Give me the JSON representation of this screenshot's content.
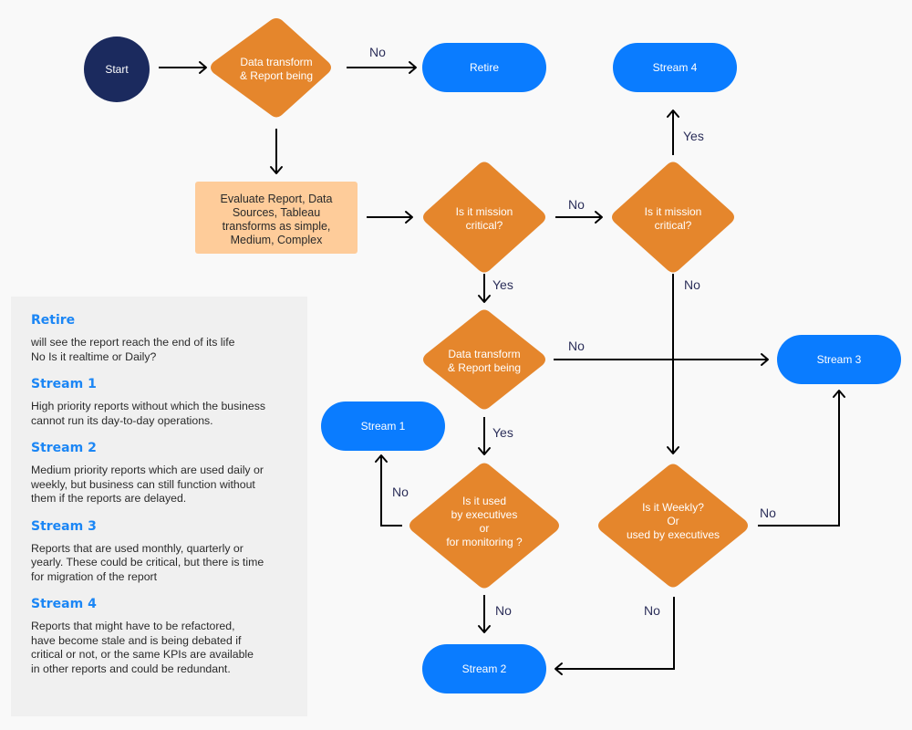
{
  "colors": {
    "start": "#1b2a5e",
    "decision": "#e5862c",
    "process": "#fecc9a",
    "terminal": "#0a7cff",
    "legend_title": "#1b86f5",
    "legend_bg": "#f0f0f0",
    "edge_label": "#2c2f5a"
  },
  "nodes": {
    "start": {
      "label": "Start"
    },
    "decision_transform_1": {
      "lines": [
        "Data transform",
        "& Report being"
      ]
    },
    "retire": {
      "label": "Retire"
    },
    "evaluate": {
      "lines": [
        "Evaluate Report, Data",
        "Sources, Tableau",
        "transforms as simple,",
        "Medium, Complex"
      ]
    },
    "decision_mission_1": {
      "lines": [
        "Is it mission",
        "critical?"
      ]
    },
    "decision_mission_2": {
      "lines": [
        "Is it mission",
        "critical?"
      ]
    },
    "stream4": {
      "label": "Stream 4"
    },
    "decision_transform_2": {
      "lines": [
        "Data transform",
        "& Report being"
      ]
    },
    "stream3": {
      "label": "Stream 3"
    },
    "stream1": {
      "label": "Stream 1"
    },
    "decision_executives": {
      "lines": [
        "Is it used",
        "by executives",
        "or",
        "for monitoring ?"
      ]
    },
    "decision_weekly": {
      "lines": [
        "Is it Weekly?",
        "Or",
        "used by executives"
      ]
    },
    "stream2": {
      "label": "Stream 2"
    }
  },
  "edges": [
    {
      "from": "start",
      "to": "decision_transform_1",
      "label": ""
    },
    {
      "from": "decision_transform_1",
      "to": "retire",
      "label": "No"
    },
    {
      "from": "decision_transform_1",
      "to": "evaluate",
      "label": ""
    },
    {
      "from": "evaluate",
      "to": "decision_mission_1",
      "label": ""
    },
    {
      "from": "decision_mission_1",
      "to": "decision_mission_2",
      "label": "No"
    },
    {
      "from": "decision_mission_2",
      "to": "stream4",
      "label": "Yes"
    },
    {
      "from": "decision_mission_1",
      "to": "decision_transform_2",
      "label": "Yes"
    },
    {
      "from": "decision_mission_2",
      "to": "decision_weekly",
      "label": "No"
    },
    {
      "from": "decision_transform_2",
      "to": "stream3",
      "label": "No"
    },
    {
      "from": "decision_transform_2",
      "to": "decision_executives",
      "label": "Yes"
    },
    {
      "from": "decision_executives",
      "to": "stream1",
      "label": "No"
    },
    {
      "from": "decision_executives",
      "to": "stream2",
      "label": "No"
    },
    {
      "from": "decision_weekly",
      "to": "stream3",
      "label": "No"
    },
    {
      "from": "decision_weekly",
      "to": "stream2",
      "label": "No"
    }
  ],
  "legend": {
    "items": [
      {
        "title": "Retire",
        "desc": "will see the report reach the end of its life\nNo Is it realtime or Daily?"
      },
      {
        "title": "Stream 1",
        "desc": "High priority reports without which the business\ncannot run its day-to-day operations."
      },
      {
        "title": "Stream 2",
        "desc": "Medium priority reports which are used daily or\nweekly, but business can still function without\nthem if the reports are delayed."
      },
      {
        "title": "Stream 3",
        "desc": "Reports that are used monthly, quarterly or\nyearly. These could be critical, but there is time\nfor migration of the report"
      },
      {
        "title": "Stream 4",
        "desc": "Reports that might have to be refactored,\nhave become stale and is being debated if\ncritical or not, or the same KPIs are available\nin other reports and could be redundant."
      }
    ]
  }
}
